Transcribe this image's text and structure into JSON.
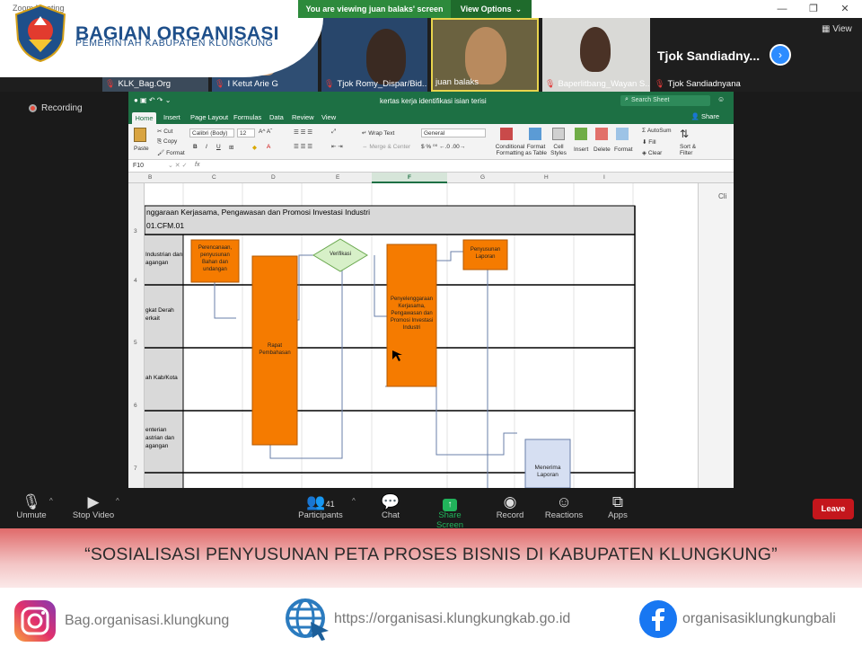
{
  "zoom": {
    "window_title": "Zoom Meeting",
    "share_banner": "You are viewing juan balaks' screen",
    "view_options": "View Options",
    "view_label": "View",
    "recording": "Recording"
  },
  "org": {
    "name": "BAGIAN ORGANISASI",
    "subtitle": "PEMERINTAH KABUPATEN KLUNGKUNG"
  },
  "participants": [
    {
      "name": "KLK_Bag.Org"
    },
    {
      "name": "I Ketut Arie G"
    },
    {
      "name": "Tjok Romy_Dispar/Bid..."
    },
    {
      "name": "juan balaks"
    },
    {
      "name": "Baperlitbang_Wayan S..."
    },
    {
      "name": "Tjok Sandiadnyana"
    }
  ],
  "big_name": "Tjok Sandiadny...",
  "excel": {
    "doc_title": "kertas kerja identifikasi isian terisi",
    "search_placeholder": "Search Sheet",
    "share": "Share",
    "tabs": [
      "Home",
      "Insert",
      "Page Layout",
      "Formulas",
      "Data",
      "Review",
      "View"
    ],
    "font_name": "Calibri (Body)",
    "font_size": "12",
    "number_format": "General",
    "ribbon": {
      "paste": "Paste",
      "cut": "Cut",
      "copy": "Copy",
      "format": "Format",
      "wrap": "Wrap Text",
      "merge": "Merge & Center",
      "cond": "Conditional Formatting",
      "fmt_table": "Format as Table",
      "cell_styles": "Cell Styles",
      "insert": "Insert",
      "delete": "Delete",
      "format_cells": "Format",
      "autosum": "AutoSum",
      "fill": "Fill",
      "clear": "Clear",
      "sort": "Sort & Filter"
    },
    "name_box": "F10",
    "fx": "fx",
    "columns": [
      "B",
      "C",
      "D",
      "E",
      "F",
      "G",
      "H",
      "I"
    ],
    "rows": [
      "3",
      "4",
      "5",
      "6",
      "7"
    ],
    "header_line1": "nggaraan Kerjasama, Pengawasan dan Promosi Investasi Industri",
    "header_line2": "01.CFM.01",
    "lanes": [
      "Industrian dan agangan",
      "gkat Derah erkait",
      "ah Kab/Kota",
      "enterian astrian dan agangan"
    ],
    "shapes": {
      "perencanaan": "Perencanaan, penyusunan Bahan dan undangan",
      "rapat": "Rapat Pembahasan",
      "verifikasi": "Verifikasi",
      "penyelenggaraan": "Penyelenggaraan Kerjasama, Pengawasan dan Promosi Investasi Industri",
      "penyusunan": "Penyusunan Laporan",
      "menerima": "Menerima Laporan"
    },
    "right_panel_label": "Cli"
  },
  "toolbar": {
    "unmute": "Unmute",
    "stop_video": "Stop Video",
    "participants": "Participants",
    "participant_count": "41",
    "chat": "Chat",
    "share_screen": "Share Screen",
    "record": "Record",
    "reactions": "Reactions",
    "apps": "Apps",
    "leave": "Leave"
  },
  "headline": "“SOSIALISASI PENYUSUNAN PETA PROSES BISNIS DI KABUPATEN KLUNGKUNG”",
  "footer": {
    "instagram": "Bag.organisasi.klungkung",
    "website": "https://organisasi.klungkungkab.go.id",
    "facebook": "organisasiklungkungbali"
  },
  "colors": {
    "excel_green": "#1d7044",
    "orange": "#f57b00",
    "zoom_blue": "#2d8cff",
    "leave_red": "#c4161c"
  }
}
